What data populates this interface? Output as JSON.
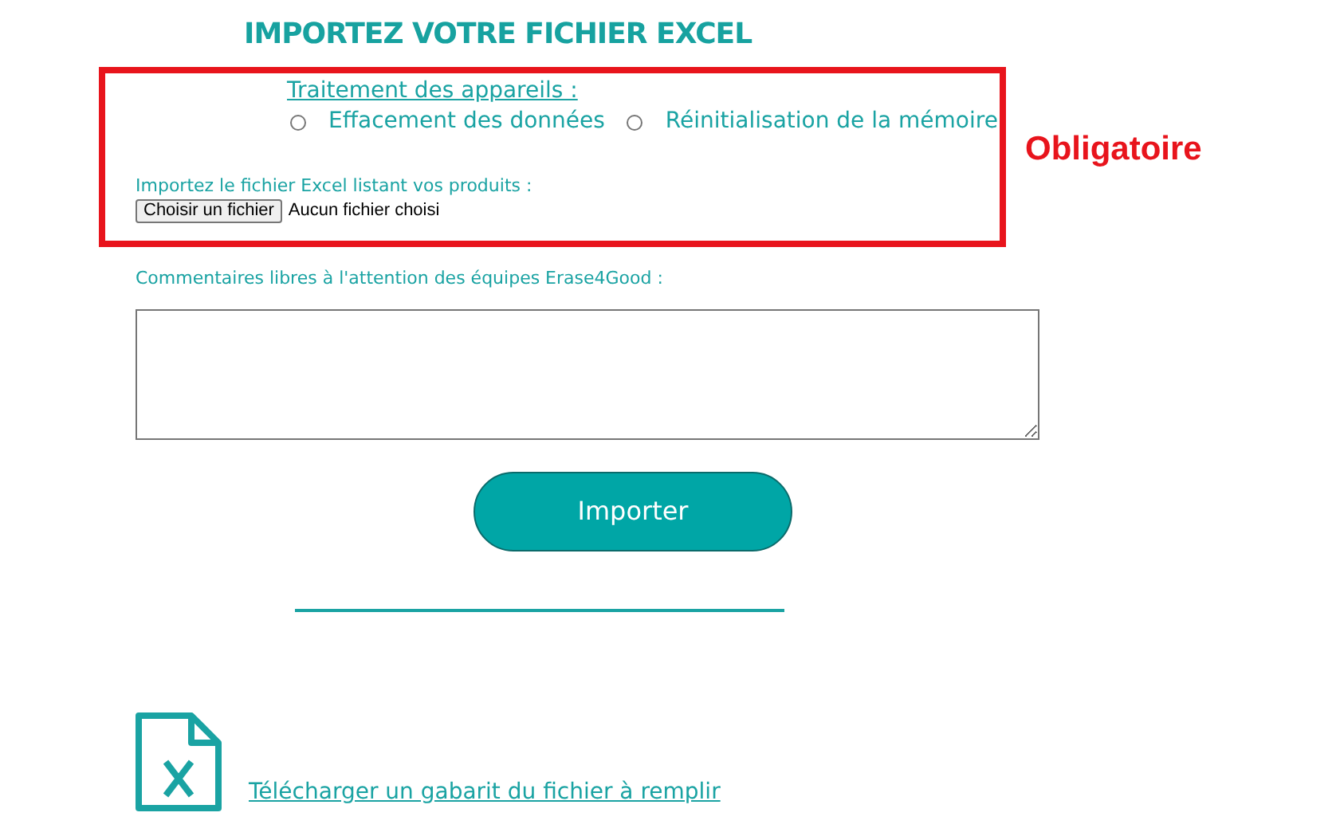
{
  "title": "IMPORTEZ VOTRE FICHIER EXCEL",
  "treatment": {
    "label": "Traitement des appareils :",
    "options": [
      {
        "label": "Effacement des données",
        "selected": false
      },
      {
        "label": "Réinitialisation de la mémoire",
        "selected": false
      }
    ]
  },
  "file_upload": {
    "label": "Importez le fichier Excel listant vos produits :",
    "button": "Choisir un fichier",
    "status": "Aucun fichier choisi"
  },
  "annotation": "Obligatoire",
  "comments": {
    "label": "Commentaires libres à l'attention des équipes Erase4Good :"
  },
  "submit": "Importer",
  "template_link": "Télécharger un gabarit du fichier à remplir"
}
